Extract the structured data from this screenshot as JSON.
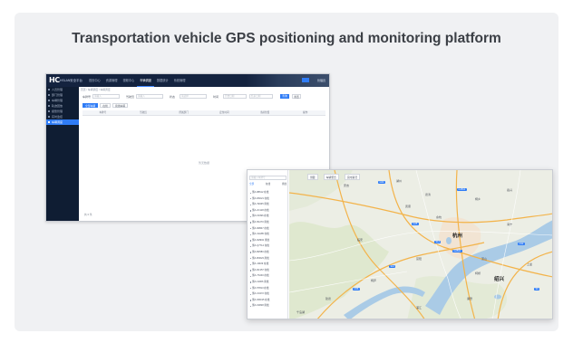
{
  "title": "Transportation vehicle GPS positioning and monitoring platform",
  "admin": {
    "logo": "HC",
    "brand": "HSLAN安全平台",
    "nav": [
      "首页中心",
      "资源管理",
      "视频中心",
      "车辆调度",
      "数据统计",
      "系统管理"
    ],
    "active_nav": 3,
    "user": "管理员",
    "sidebar": [
      "人员管理",
      "部门管理",
      "车辆管理",
      "轨迹回放",
      "报警管理",
      "实时监控",
      "车辆调度"
    ],
    "active_side": 6,
    "breadcrumb": "首页 / 车辆调度 / 车辆调度",
    "filter": {
      "fields": [
        {
          "label": "车牌号",
          "placeholder": "请输入"
        },
        {
          "label": "驾驶员",
          "placeholder": "请输入"
        },
        {
          "label": "状态",
          "placeholder": "请选择"
        },
        {
          "label": "时间",
          "placeholder": "开始日期"
        }
      ],
      "end_placeholder": "结束日期",
      "search": "查询",
      "reset": "重置"
    },
    "tabs": [
      "全部车辆",
      "在线",
      "离线车辆"
    ],
    "columns": [
      "车牌号",
      "驾驶员",
      "所属部门",
      "定位时间",
      "当前位置",
      "操作"
    ],
    "empty": "暂无数据",
    "total": "共 0 条"
  },
  "map": {
    "search_placeholder": "请输入车牌号",
    "panel_tabs": [
      "全部",
      "在线",
      "离线"
    ],
    "tools": [
      "测距",
      "车辆聚合",
      "实时路况"
    ],
    "vehicles": [
      "浙A·88612 在线",
      "浙A·D6021 在线",
      "浙A·7E935 离线",
      "浙A·2C118 在线",
      "浙A·F3396 在线",
      "浙A·5K270 离线",
      "浙A·90B47 在线",
      "浙A·31H85 在线",
      "浙A·6M902 离线",
      "浙A·Q7714 在线",
      "浙A·B2580 在线",
      "浙A·8N623 离线",
      "浙A·J4409 在线",
      "浙A·R1357 在线",
      "浙A·7X240 在线",
      "浙A·L9066 离线",
      "浙A·5T813 在线",
      "浙A·C0472 在线",
      "浙A·W6195 在线",
      "浙A·K3828 离线"
    ],
    "places": {
      "hangzhou": "杭州",
      "xiaoshan": "萧山",
      "shaoxing": "绍兴",
      "fuyang": "富阳",
      "linan": "临安",
      "deqing": "德清",
      "haining": "海宁",
      "yuhang": "余杭",
      "tonglu": "桐庐",
      "zhuji": "诸暨",
      "anji": "安吉",
      "huzhou": "湖州",
      "jiaxing": "嘉兴",
      "tongxiang": "桐乡",
      "pujiang": "浦江",
      "shangyu": "上虞",
      "keqiao": "柯桥",
      "jiande": "建德",
      "wukang": "武康",
      "qiandao": "千岛湖"
    },
    "badges": [
      "G60",
      "G25",
      "S13",
      "G92",
      "G56",
      "G2504",
      "S12",
      "G1512",
      "S9"
    ]
  },
  "colors": {
    "card_bg": "#f0f1f3",
    "admin_header": "#14233f",
    "accent": "#2f7cf6",
    "map_land": "#eceee5",
    "map_water": "#aacbe6"
  }
}
